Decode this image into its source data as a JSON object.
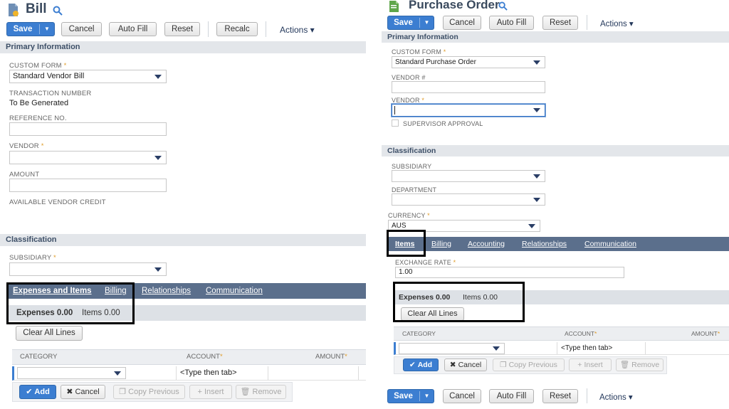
{
  "left": {
    "title": "Bill",
    "toolbar": {
      "save_label": "Save",
      "save_arrow": "▼",
      "cancel_label": "Cancel",
      "autofill_label": "Auto Fill",
      "reset_label": "Reset",
      "recalc_label": "Recalc",
      "actions_label": "Actions ▾"
    },
    "primary_section": "Primary Information",
    "custom_form": {
      "label": "CUSTOM FORM",
      "required": "*",
      "value": "Standard Vendor Bill"
    },
    "transaction_number": {
      "label": "TRANSACTION NUMBER",
      "value": "To Be Generated"
    },
    "reference_no": {
      "label": "REFERENCE NO.",
      "value": ""
    },
    "vendor": {
      "label": "VENDOR",
      "required": "*",
      "value": ""
    },
    "amount": {
      "label": "AMOUNT",
      "value": ""
    },
    "available_vendor_credit": {
      "label": "AVAILABLE VENDOR CREDIT"
    },
    "classification_section": "Classification",
    "subsidiary": {
      "label": "SUBSIDIARY",
      "required": "*",
      "value": ""
    },
    "tabs": [
      "Expenses and Items",
      "Billing",
      "Relationships",
      "Communication"
    ],
    "subtabs": [
      "Expenses 0.00",
      "Items 0.00"
    ],
    "clear_all_lines": "Clear All Lines",
    "grid": {
      "headers": [
        "CATEGORY",
        "ACCOUNT",
        "AMOUNT"
      ],
      "required": "*",
      "account_placeholder": "<Type then tab>"
    },
    "row_buttons": [
      "Add",
      "Cancel",
      "Copy Previous",
      "Insert",
      "Remove"
    ]
  },
  "right": {
    "title": "Purchase Order",
    "toolbar": {
      "save_label": "Save",
      "save_arrow": "▼",
      "cancel_label": "Cancel",
      "autofill_label": "Auto Fill",
      "reset_label": "Reset",
      "actions_label": "Actions ▾"
    },
    "primary_section": "Primary Information",
    "custom_form": {
      "label": "CUSTOM FORM",
      "required": "*",
      "value": "Standard Purchase Order"
    },
    "vendor_no": {
      "label": "VENDOR #",
      "value": ""
    },
    "vendor": {
      "label": "VENDOR",
      "required": "*",
      "value": ""
    },
    "supervisor_approval": {
      "label": "SUPERVISOR APPROVAL"
    },
    "classification_section": "Classification",
    "subsidiary": {
      "label": "SUBSIDIARY",
      "value": ""
    },
    "department": {
      "label": "DEPARTMENT",
      "value": ""
    },
    "currency": {
      "label": "CURRENCY",
      "required": "*",
      "value": "AUS"
    },
    "tabs": [
      "Items",
      "Billing",
      "Accounting",
      "Relationships",
      "Communication"
    ],
    "exchange_rate": {
      "label": "EXCHANGE RATE",
      "required": "*",
      "value": "1.00"
    },
    "subtabs": [
      "Expenses 0.00",
      "Items 0.00"
    ],
    "clear_all_lines": "Clear All Lines",
    "grid": {
      "headers": [
        "CATEGORY",
        "ACCOUNT",
        "AMOUNT"
      ],
      "required": "*",
      "account_placeholder": "<Type then tab>"
    },
    "row_buttons": [
      "Add",
      "Cancel",
      "Copy Previous",
      "Insert",
      "Remove"
    ],
    "bottom_toolbar": {
      "save_label": "Save",
      "save_arrow": "▼",
      "cancel_label": "Cancel",
      "autofill_label": "Auto Fill",
      "reset_label": "Reset",
      "actions_label": "Actions ▾"
    }
  },
  "colors": {
    "primary_blue": "#3c7ed1",
    "tab_bar": "#5b6f8c",
    "section_header": "#e3e6ea",
    "required_star": "#e09c2a",
    "highlight_box": "#000000"
  }
}
